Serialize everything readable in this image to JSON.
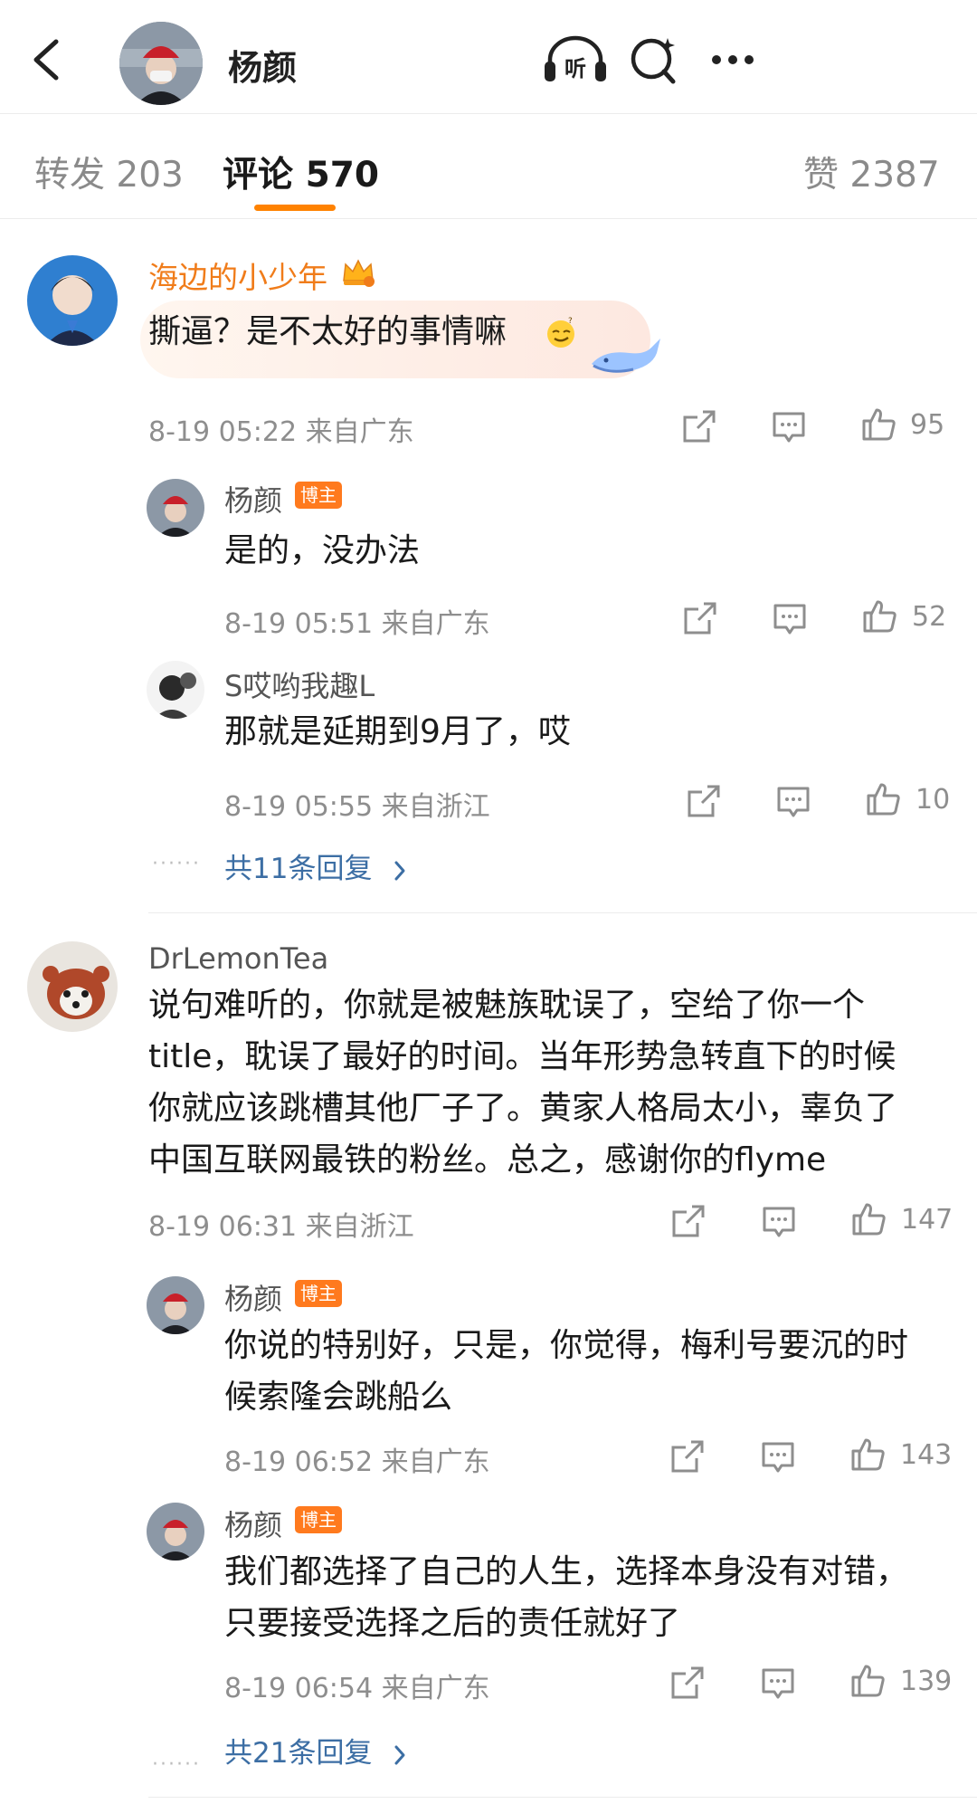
{
  "header": {
    "name": "杨颜"
  },
  "tabs": {
    "repost": "转发 203",
    "comments": "评论 570",
    "likes": "赞 2387"
  },
  "badge_label": "博主",
  "comments": [
    {
      "user": "海边的小少年",
      "text": "撕逼？是不太好的事情嘛",
      "meta": "8-19 05:22  来自广东",
      "likes": "95",
      "replies": [
        {
          "user": "杨颜",
          "text": "是的，没办法",
          "meta": "8-19 05:51  来自广东",
          "likes": "52"
        },
        {
          "user": "S哎哟我趣L",
          "text": "那就是延期到9月了，哎",
          "meta": "8-19 05:55  来自浙江",
          "likes": "10"
        }
      ],
      "more_replies": "共11条回复"
    },
    {
      "user": "DrLemonTea",
      "text_lines": [
        "说句难听的，你就是被魅族耽误了，空给了你一个",
        "title，耽误了最好的时间。当年形势急转直下的时候",
        "你就应该跳槽其他厂子了。黄家人格局太小，辜负了",
        "中国互联网最铁的粉丝。总之，感谢你的flyme"
      ],
      "meta": "8-19 06:31  来自浙江",
      "likes": "147",
      "replies": [
        {
          "user": "杨颜",
          "text_lines": [
            "你说的特别好，只是，你觉得，梅利号要沉的时",
            "候索隆会跳船么"
          ],
          "meta": "8-19 06:52  来自广东",
          "likes": "143"
        },
        {
          "user": "杨颜",
          "text_lines": [
            "我们都选择了自己的人生，选择本身没有对错，",
            "只要接受选择之后的责任就好了"
          ],
          "meta": "8-19 06:54  来自广东",
          "likes": "139"
        }
      ],
      "more_replies": "共21条回复"
    }
  ],
  "colors": {
    "accent": "#ff8200",
    "link": "#3c6ea4",
    "vip_name": "#f07c1a",
    "badge": "#ff7a1e"
  },
  "icons": [
    "back-icon",
    "listen-icon",
    "search-icon",
    "more-icon",
    "share-icon",
    "comment-icon",
    "like-icon",
    "chevron-right-icon",
    "crown-icon",
    "smirk-emoji-icon",
    "whale-icon"
  ]
}
